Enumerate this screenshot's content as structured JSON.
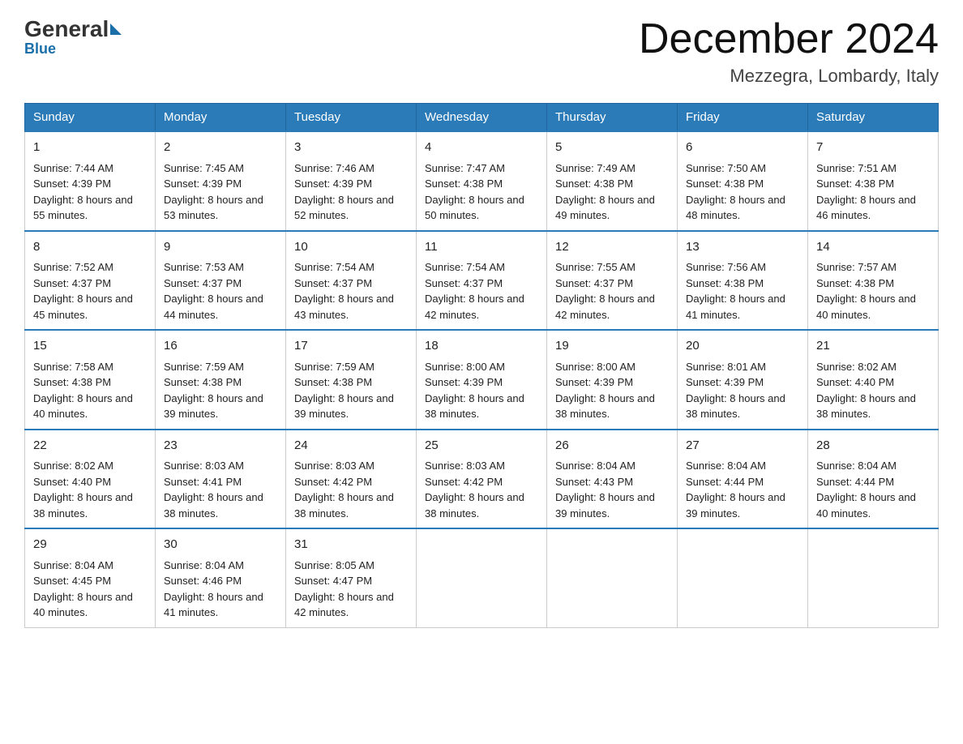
{
  "header": {
    "logo_general": "General",
    "logo_blue": "Blue",
    "month_title": "December 2024",
    "location": "Mezzegra, Lombardy, Italy"
  },
  "days_of_week": [
    "Sunday",
    "Monday",
    "Tuesday",
    "Wednesday",
    "Thursday",
    "Friday",
    "Saturday"
  ],
  "weeks": [
    [
      {
        "day": "1",
        "sunrise": "7:44 AM",
        "sunset": "4:39 PM",
        "daylight": "8 hours and 55 minutes."
      },
      {
        "day": "2",
        "sunrise": "7:45 AM",
        "sunset": "4:39 PM",
        "daylight": "8 hours and 53 minutes."
      },
      {
        "day": "3",
        "sunrise": "7:46 AM",
        "sunset": "4:39 PM",
        "daylight": "8 hours and 52 minutes."
      },
      {
        "day": "4",
        "sunrise": "7:47 AM",
        "sunset": "4:38 PM",
        "daylight": "8 hours and 50 minutes."
      },
      {
        "day": "5",
        "sunrise": "7:49 AM",
        "sunset": "4:38 PM",
        "daylight": "8 hours and 49 minutes."
      },
      {
        "day": "6",
        "sunrise": "7:50 AM",
        "sunset": "4:38 PM",
        "daylight": "8 hours and 48 minutes."
      },
      {
        "day": "7",
        "sunrise": "7:51 AM",
        "sunset": "4:38 PM",
        "daylight": "8 hours and 46 minutes."
      }
    ],
    [
      {
        "day": "8",
        "sunrise": "7:52 AM",
        "sunset": "4:37 PM",
        "daylight": "8 hours and 45 minutes."
      },
      {
        "day": "9",
        "sunrise": "7:53 AM",
        "sunset": "4:37 PM",
        "daylight": "8 hours and 44 minutes."
      },
      {
        "day": "10",
        "sunrise": "7:54 AM",
        "sunset": "4:37 PM",
        "daylight": "8 hours and 43 minutes."
      },
      {
        "day": "11",
        "sunrise": "7:54 AM",
        "sunset": "4:37 PM",
        "daylight": "8 hours and 42 minutes."
      },
      {
        "day": "12",
        "sunrise": "7:55 AM",
        "sunset": "4:37 PM",
        "daylight": "8 hours and 42 minutes."
      },
      {
        "day": "13",
        "sunrise": "7:56 AM",
        "sunset": "4:38 PM",
        "daylight": "8 hours and 41 minutes."
      },
      {
        "day": "14",
        "sunrise": "7:57 AM",
        "sunset": "4:38 PM",
        "daylight": "8 hours and 40 minutes."
      }
    ],
    [
      {
        "day": "15",
        "sunrise": "7:58 AM",
        "sunset": "4:38 PM",
        "daylight": "8 hours and 40 minutes."
      },
      {
        "day": "16",
        "sunrise": "7:59 AM",
        "sunset": "4:38 PM",
        "daylight": "8 hours and 39 minutes."
      },
      {
        "day": "17",
        "sunrise": "7:59 AM",
        "sunset": "4:38 PM",
        "daylight": "8 hours and 39 minutes."
      },
      {
        "day": "18",
        "sunrise": "8:00 AM",
        "sunset": "4:39 PM",
        "daylight": "8 hours and 38 minutes."
      },
      {
        "day": "19",
        "sunrise": "8:00 AM",
        "sunset": "4:39 PM",
        "daylight": "8 hours and 38 minutes."
      },
      {
        "day": "20",
        "sunrise": "8:01 AM",
        "sunset": "4:39 PM",
        "daylight": "8 hours and 38 minutes."
      },
      {
        "day": "21",
        "sunrise": "8:02 AM",
        "sunset": "4:40 PM",
        "daylight": "8 hours and 38 minutes."
      }
    ],
    [
      {
        "day": "22",
        "sunrise": "8:02 AM",
        "sunset": "4:40 PM",
        "daylight": "8 hours and 38 minutes."
      },
      {
        "day": "23",
        "sunrise": "8:03 AM",
        "sunset": "4:41 PM",
        "daylight": "8 hours and 38 minutes."
      },
      {
        "day": "24",
        "sunrise": "8:03 AM",
        "sunset": "4:42 PM",
        "daylight": "8 hours and 38 minutes."
      },
      {
        "day": "25",
        "sunrise": "8:03 AM",
        "sunset": "4:42 PM",
        "daylight": "8 hours and 38 minutes."
      },
      {
        "day": "26",
        "sunrise": "8:04 AM",
        "sunset": "4:43 PM",
        "daylight": "8 hours and 39 minutes."
      },
      {
        "day": "27",
        "sunrise": "8:04 AM",
        "sunset": "4:44 PM",
        "daylight": "8 hours and 39 minutes."
      },
      {
        "day": "28",
        "sunrise": "8:04 AM",
        "sunset": "4:44 PM",
        "daylight": "8 hours and 40 minutes."
      }
    ],
    [
      {
        "day": "29",
        "sunrise": "8:04 AM",
        "sunset": "4:45 PM",
        "daylight": "8 hours and 40 minutes."
      },
      {
        "day": "30",
        "sunrise": "8:04 AM",
        "sunset": "4:46 PM",
        "daylight": "8 hours and 41 minutes."
      },
      {
        "day": "31",
        "sunrise": "8:05 AM",
        "sunset": "4:47 PM",
        "daylight": "8 hours and 42 minutes."
      },
      null,
      null,
      null,
      null
    ]
  ],
  "labels": {
    "sunrise": "Sunrise:",
    "sunset": "Sunset:",
    "daylight": "Daylight:"
  }
}
